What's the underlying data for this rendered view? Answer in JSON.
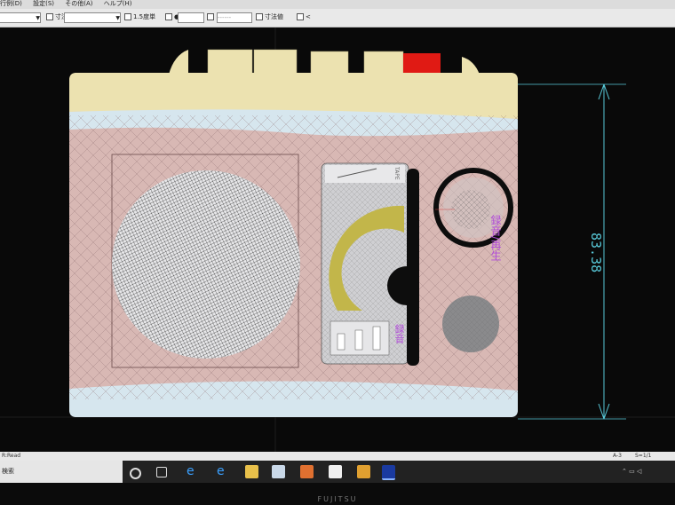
{
  "menubar": {
    "items": [
      "行例(D)",
      "設定(S)",
      "その他(A)",
      "ヘルプ(H)"
    ]
  },
  "toolbar": {
    "dim_label": "寸法",
    "check_15": "1.5度単",
    "check_dim": "寸法値",
    "check_less": "<"
  },
  "drawing": {
    "dimension_value": "83.38",
    "label_record_play": "録音/再生",
    "label_rec": "録音",
    "label_tape": "TAPE"
  },
  "statusbar": {
    "left_text": "R:Read",
    "search_text": "検索",
    "right_a": "A-3",
    "right_b": "S=1/1"
  },
  "taskbar": {
    "icons": [
      "search-icon",
      "task-view-icon",
      "edge-icon",
      "ie-icon",
      "explorer-icon",
      "store-icon",
      "media-icon",
      "mail-icon",
      "app-icon",
      "jw-cad-icon"
    ]
  },
  "laptop": {
    "brand": "FUJITSU"
  },
  "colors": {
    "body_pink": "#d8b8b4",
    "top_cream": "#ece2b0",
    "band_lightblue": "#d6e6ee",
    "record_button": "#e01a14",
    "dimension_cyan": "#58c8d8",
    "label_purple": "#b04ad8",
    "dial_olive": "#c2b64a"
  }
}
